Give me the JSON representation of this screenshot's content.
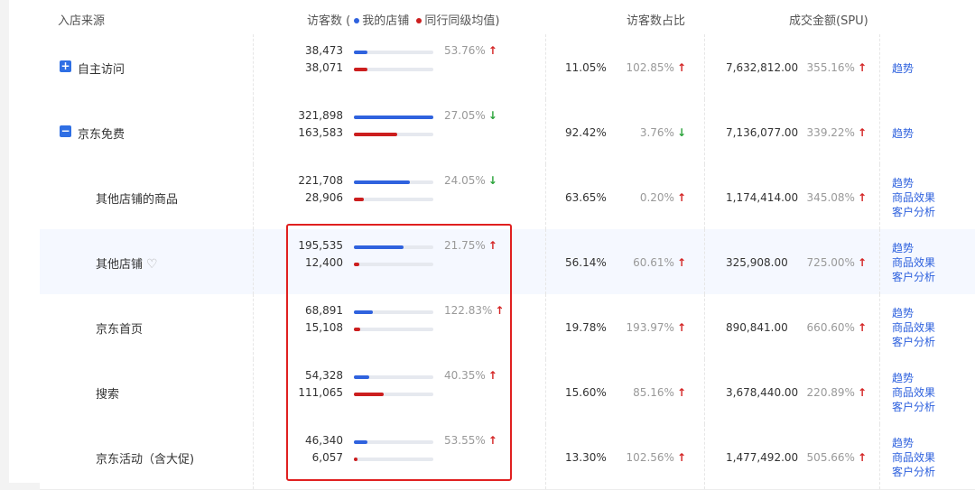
{
  "header": {
    "source": "入店来源",
    "visitors": "访客数",
    "legend_open": "(",
    "legend_mine": "我的店铺",
    "legend_peer": "同行同级均值)",
    "share": "访客数占比",
    "gmv": "成交金额(SPU)"
  },
  "colors": {
    "mine": "#2f62de",
    "peer": "#cc1e1e",
    "up": "#d42424",
    "down": "#2aa33a",
    "highlight": "#e02020"
  },
  "rows": [
    {
      "source": "自主访问",
      "toggle": "+",
      "mine": "38,473",
      "peer": "38,071",
      "mine_frac": 0.17,
      "peer_frac": 0.17,
      "vis_pct": "53.76%",
      "vis_dir": "up",
      "share": "11.05%",
      "share_pct": "102.85%",
      "share_dir": "up",
      "gmv": "7,632,812.00",
      "gmv_pct": "355.16%",
      "gmv_dir": "up",
      "links": [
        "趋势"
      ]
    },
    {
      "source": "京东免费",
      "toggle": "−",
      "mine": "321,898",
      "peer": "163,583",
      "mine_frac": 1.0,
      "peer_frac": 0.54,
      "vis_pct": "27.05%",
      "vis_dir": "down",
      "share": "92.42%",
      "share_pct": "3.76%",
      "share_dir": "down",
      "gmv": "7,136,077.00",
      "gmv_pct": "339.22%",
      "gmv_dir": "up",
      "links": [
        "趋势"
      ]
    },
    {
      "source": "其他店铺的商品",
      "mine": "221,708",
      "peer": "28,906",
      "mine_frac": 0.7,
      "peer_frac": 0.12,
      "vis_pct": "24.05%",
      "vis_dir": "down",
      "share": "63.65%",
      "share_pct": "0.20%",
      "share_dir": "up",
      "gmv": "1,174,414.00",
      "gmv_pct": "345.08%",
      "gmv_dir": "up",
      "links": [
        "趋势",
        "商品效果",
        "客户分析"
      ]
    },
    {
      "source": "其他店铺",
      "heart": true,
      "mine": "195,535",
      "peer": "12,400",
      "mine_frac": 0.63,
      "peer_frac": 0.07,
      "vis_pct": "21.75%",
      "vis_dir": "up",
      "share": "56.14%",
      "share_pct": "60.61%",
      "share_dir": "up",
      "gmv": "325,908.00",
      "gmv_pct": "725.00%",
      "gmv_dir": "up",
      "links": [
        "趋势",
        "商品效果",
        "客户分析"
      ]
    },
    {
      "source": "京东首页",
      "mine": "68,891",
      "peer": "15,108",
      "mine_frac": 0.24,
      "peer_frac": 0.08,
      "vis_pct": "122.83%",
      "vis_dir": "up",
      "share": "19.78%",
      "share_pct": "193.97%",
      "share_dir": "up",
      "gmv": "890,841.00",
      "gmv_pct": "660.60%",
      "gmv_dir": "up",
      "links": [
        "趋势",
        "商品效果",
        "客户分析"
      ]
    },
    {
      "source": "搜索",
      "mine": "54,328",
      "peer": "111,065",
      "mine_frac": 0.19,
      "peer_frac": 0.37,
      "vis_pct": "40.35%",
      "vis_dir": "up",
      "share": "15.60%",
      "share_pct": "85.16%",
      "share_dir": "up",
      "gmv": "3,678,440.00",
      "gmv_pct": "220.89%",
      "gmv_dir": "up",
      "links": [
        "趋势",
        "商品效果",
        "客户分析"
      ]
    },
    {
      "source": "京东活动（含大促)",
      "mine": "46,340",
      "peer": "6,057",
      "mine_frac": 0.17,
      "peer_frac": 0.05,
      "vis_pct": "53.55%",
      "vis_dir": "up",
      "share": "13.30%",
      "share_pct": "102.56%",
      "share_dir": "up",
      "gmv": "1,477,492.00",
      "gmv_pct": "505.66%",
      "gmv_dir": "up",
      "links": [
        "趋势",
        "商品效果",
        "客户分析"
      ]
    }
  ]
}
